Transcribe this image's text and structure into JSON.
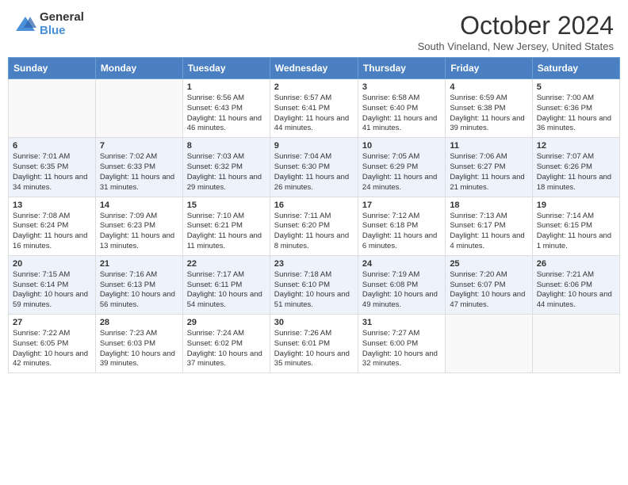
{
  "header": {
    "logo_general": "General",
    "logo_blue": "Blue",
    "month_title": "October 2024",
    "location": "South Vineland, New Jersey, United States"
  },
  "weekdays": [
    "Sunday",
    "Monday",
    "Tuesday",
    "Wednesday",
    "Thursday",
    "Friday",
    "Saturday"
  ],
  "weeks": [
    [
      {
        "day": "",
        "sunrise": "",
        "sunset": "",
        "daylight": ""
      },
      {
        "day": "",
        "sunrise": "",
        "sunset": "",
        "daylight": ""
      },
      {
        "day": "1",
        "sunrise": "Sunrise: 6:56 AM",
        "sunset": "Sunset: 6:43 PM",
        "daylight": "Daylight: 11 hours and 46 minutes."
      },
      {
        "day": "2",
        "sunrise": "Sunrise: 6:57 AM",
        "sunset": "Sunset: 6:41 PM",
        "daylight": "Daylight: 11 hours and 44 minutes."
      },
      {
        "day": "3",
        "sunrise": "Sunrise: 6:58 AM",
        "sunset": "Sunset: 6:40 PM",
        "daylight": "Daylight: 11 hours and 41 minutes."
      },
      {
        "day": "4",
        "sunrise": "Sunrise: 6:59 AM",
        "sunset": "Sunset: 6:38 PM",
        "daylight": "Daylight: 11 hours and 39 minutes."
      },
      {
        "day": "5",
        "sunrise": "Sunrise: 7:00 AM",
        "sunset": "Sunset: 6:36 PM",
        "daylight": "Daylight: 11 hours and 36 minutes."
      }
    ],
    [
      {
        "day": "6",
        "sunrise": "Sunrise: 7:01 AM",
        "sunset": "Sunset: 6:35 PM",
        "daylight": "Daylight: 11 hours and 34 minutes."
      },
      {
        "day": "7",
        "sunrise": "Sunrise: 7:02 AM",
        "sunset": "Sunset: 6:33 PM",
        "daylight": "Daylight: 11 hours and 31 minutes."
      },
      {
        "day": "8",
        "sunrise": "Sunrise: 7:03 AM",
        "sunset": "Sunset: 6:32 PM",
        "daylight": "Daylight: 11 hours and 29 minutes."
      },
      {
        "day": "9",
        "sunrise": "Sunrise: 7:04 AM",
        "sunset": "Sunset: 6:30 PM",
        "daylight": "Daylight: 11 hours and 26 minutes."
      },
      {
        "day": "10",
        "sunrise": "Sunrise: 7:05 AM",
        "sunset": "Sunset: 6:29 PM",
        "daylight": "Daylight: 11 hours and 24 minutes."
      },
      {
        "day": "11",
        "sunrise": "Sunrise: 7:06 AM",
        "sunset": "Sunset: 6:27 PM",
        "daylight": "Daylight: 11 hours and 21 minutes."
      },
      {
        "day": "12",
        "sunrise": "Sunrise: 7:07 AM",
        "sunset": "Sunset: 6:26 PM",
        "daylight": "Daylight: 11 hours and 18 minutes."
      }
    ],
    [
      {
        "day": "13",
        "sunrise": "Sunrise: 7:08 AM",
        "sunset": "Sunset: 6:24 PM",
        "daylight": "Daylight: 11 hours and 16 minutes."
      },
      {
        "day": "14",
        "sunrise": "Sunrise: 7:09 AM",
        "sunset": "Sunset: 6:23 PM",
        "daylight": "Daylight: 11 hours and 13 minutes."
      },
      {
        "day": "15",
        "sunrise": "Sunrise: 7:10 AM",
        "sunset": "Sunset: 6:21 PM",
        "daylight": "Daylight: 11 hours and 11 minutes."
      },
      {
        "day": "16",
        "sunrise": "Sunrise: 7:11 AM",
        "sunset": "Sunset: 6:20 PM",
        "daylight": "Daylight: 11 hours and 8 minutes."
      },
      {
        "day": "17",
        "sunrise": "Sunrise: 7:12 AM",
        "sunset": "Sunset: 6:18 PM",
        "daylight": "Daylight: 11 hours and 6 minutes."
      },
      {
        "day": "18",
        "sunrise": "Sunrise: 7:13 AM",
        "sunset": "Sunset: 6:17 PM",
        "daylight": "Daylight: 11 hours and 4 minutes."
      },
      {
        "day": "19",
        "sunrise": "Sunrise: 7:14 AM",
        "sunset": "Sunset: 6:15 PM",
        "daylight": "Daylight: 11 hours and 1 minute."
      }
    ],
    [
      {
        "day": "20",
        "sunrise": "Sunrise: 7:15 AM",
        "sunset": "Sunset: 6:14 PM",
        "daylight": "Daylight: 10 hours and 59 minutes."
      },
      {
        "day": "21",
        "sunrise": "Sunrise: 7:16 AM",
        "sunset": "Sunset: 6:13 PM",
        "daylight": "Daylight: 10 hours and 56 minutes."
      },
      {
        "day": "22",
        "sunrise": "Sunrise: 7:17 AM",
        "sunset": "Sunset: 6:11 PM",
        "daylight": "Daylight: 10 hours and 54 minutes."
      },
      {
        "day": "23",
        "sunrise": "Sunrise: 7:18 AM",
        "sunset": "Sunset: 6:10 PM",
        "daylight": "Daylight: 10 hours and 51 minutes."
      },
      {
        "day": "24",
        "sunrise": "Sunrise: 7:19 AM",
        "sunset": "Sunset: 6:08 PM",
        "daylight": "Daylight: 10 hours and 49 minutes."
      },
      {
        "day": "25",
        "sunrise": "Sunrise: 7:20 AM",
        "sunset": "Sunset: 6:07 PM",
        "daylight": "Daylight: 10 hours and 47 minutes."
      },
      {
        "day": "26",
        "sunrise": "Sunrise: 7:21 AM",
        "sunset": "Sunset: 6:06 PM",
        "daylight": "Daylight: 10 hours and 44 minutes."
      }
    ],
    [
      {
        "day": "27",
        "sunrise": "Sunrise: 7:22 AM",
        "sunset": "Sunset: 6:05 PM",
        "daylight": "Daylight: 10 hours and 42 minutes."
      },
      {
        "day": "28",
        "sunrise": "Sunrise: 7:23 AM",
        "sunset": "Sunset: 6:03 PM",
        "daylight": "Daylight: 10 hours and 39 minutes."
      },
      {
        "day": "29",
        "sunrise": "Sunrise: 7:24 AM",
        "sunset": "Sunset: 6:02 PM",
        "daylight": "Daylight: 10 hours and 37 minutes."
      },
      {
        "day": "30",
        "sunrise": "Sunrise: 7:26 AM",
        "sunset": "Sunset: 6:01 PM",
        "daylight": "Daylight: 10 hours and 35 minutes."
      },
      {
        "day": "31",
        "sunrise": "Sunrise: 7:27 AM",
        "sunset": "Sunset: 6:00 PM",
        "daylight": "Daylight: 10 hours and 32 minutes."
      },
      {
        "day": "",
        "sunrise": "",
        "sunset": "",
        "daylight": ""
      },
      {
        "day": "",
        "sunrise": "",
        "sunset": "",
        "daylight": ""
      }
    ]
  ]
}
